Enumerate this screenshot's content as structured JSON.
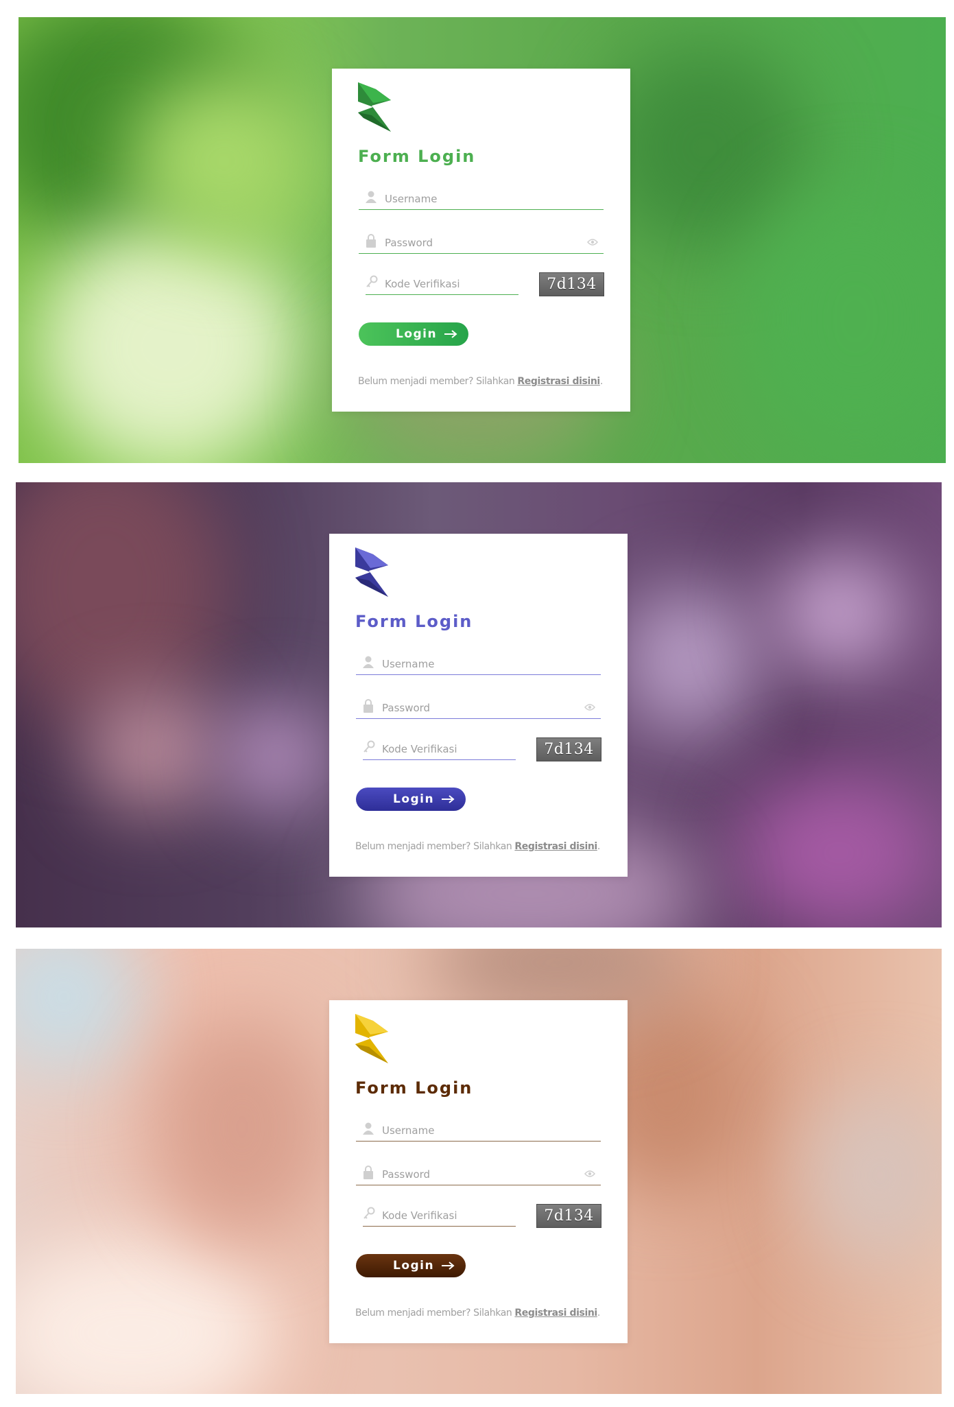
{
  "variants": [
    {
      "theme": "green",
      "accent": "#4caf50",
      "title": "Form Login",
      "username_placeholder": "Username",
      "password_placeholder": "Password",
      "verification_placeholder": "Kode Verifikasi",
      "captcha_code": "7d134",
      "login_label": "Login",
      "footer_text": "Belum menjadi member? Silahkan ",
      "register_link": "Registrasi disini",
      "footer_end": "."
    },
    {
      "theme": "purple",
      "accent": "#5c5cc8",
      "title": "Form Login",
      "username_placeholder": "Username",
      "password_placeholder": "Password",
      "verification_placeholder": "Kode Verifikasi",
      "captcha_code": "7d134",
      "login_label": "Login",
      "footer_text": "Belum menjadi member? Silahkan ",
      "register_link": "Registrasi disini",
      "footer_end": "."
    },
    {
      "theme": "brown",
      "accent": "#5c2b05",
      "title": "Form Login",
      "username_placeholder": "Username",
      "password_placeholder": "Password",
      "verification_placeholder": "Kode Verifikasi",
      "captcha_code": "7d134",
      "login_label": "Login",
      "footer_text": "Belum menjadi member? Silahkan ",
      "register_link": "Registrasi disini",
      "footer_end": "."
    }
  ],
  "icons": [
    "user-icon",
    "lock-icon",
    "eye-icon",
    "key-icon",
    "arrow-right-icon",
    "logo-icon"
  ]
}
